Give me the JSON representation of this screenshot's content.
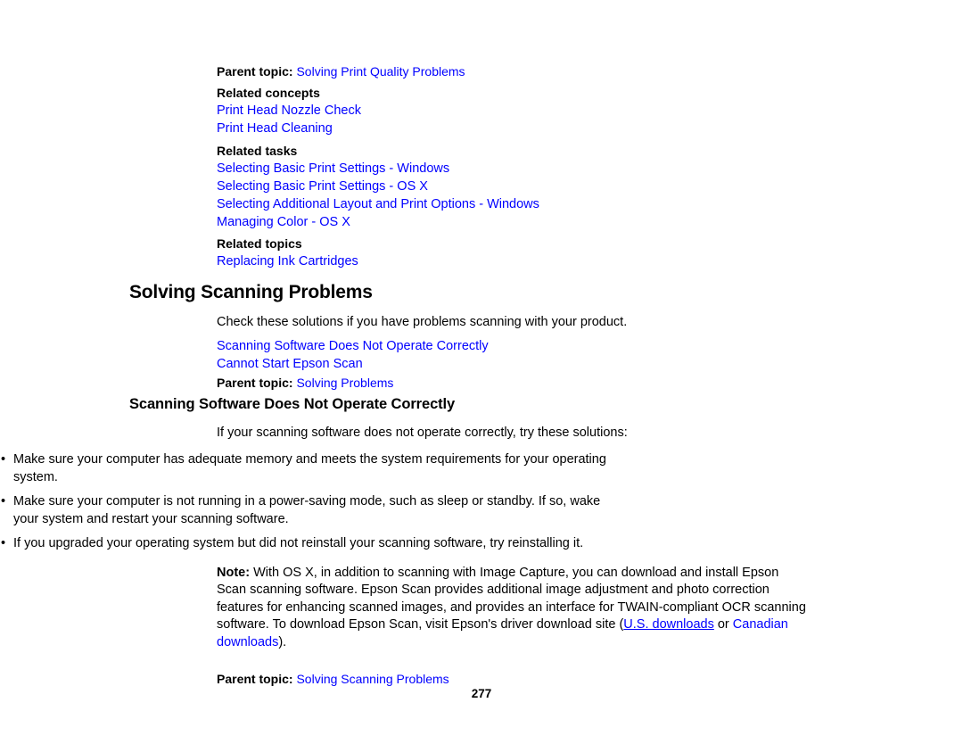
{
  "document": {
    "page_number": "277",
    "link_color": "#0000ff",
    "text_color": "#000000",
    "background": "#ffffff"
  },
  "top_parent_topic": {
    "label": "Parent topic:",
    "link": "Solving Print Quality Problems"
  },
  "related_concepts": {
    "heading": "Related concepts",
    "links": [
      "Print Head Nozzle Check",
      "Print Head Cleaning"
    ]
  },
  "related_tasks": {
    "heading": "Related tasks",
    "links": [
      "Selecting Basic Print Settings - Windows",
      "Selecting Basic Print Settings - OS X",
      "Selecting Additional Layout and Print Options - Windows",
      "Managing Color - OS X"
    ]
  },
  "related_topics": {
    "heading": "Related topics",
    "links": [
      "Replacing Ink Cartridges"
    ]
  },
  "section_main": {
    "title": "Solving Scanning Problems",
    "intro": "Check these solutions if you have problems scanning with your product.",
    "links": [
      "Scanning Software Does Not Operate Correctly",
      "Cannot Start Epson Scan"
    ],
    "parent_topic": {
      "label": "Parent topic:",
      "link": "Solving Problems"
    }
  },
  "section_sub": {
    "title": "Scanning Software Does Not Operate Correctly",
    "intro": "If your scanning software does not operate correctly, try these solutions:",
    "bullet_marker": "•",
    "bullets": [
      "Make sure your computer has adequate memory and meets the system requirements for your operating system.",
      "Make sure your computer is not running in a power-saving mode, such as sleep or standby. If so, wake your system and restart your scanning software.",
      "If you upgraded your operating system but did not reinstall your scanning software, try reinstalling it."
    ],
    "note": {
      "label": "Note:",
      "text_part_1": " With OS X, in addition to scanning with Image Capture, you can download and install Epson Scan scanning software. Epson Scan provides additional image adjustment and photo correction features for enhancing scanned images, and provides an interface for TWAIN-compliant OCR scanning software. To download Epson Scan, visit Epson's driver download site (",
      "link_us": "U.S. downloads",
      "text_part_2": " or ",
      "link_ca": "Canadian downloads",
      "text_part_3": ")."
    },
    "parent_topic": {
      "label": "Parent topic:",
      "link": "Solving Scanning Problems"
    }
  }
}
